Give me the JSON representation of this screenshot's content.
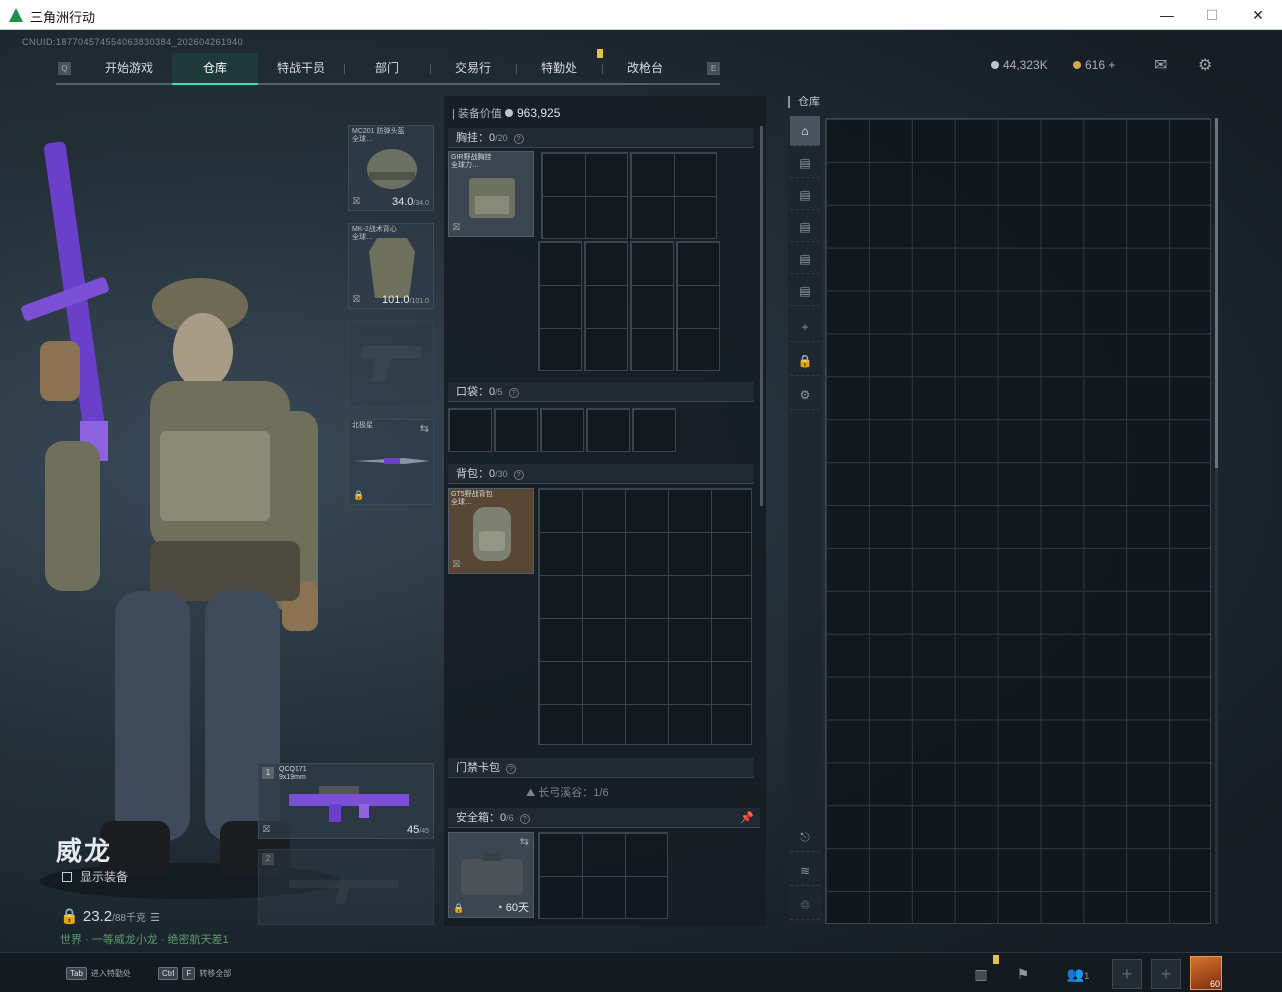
{
  "window": {
    "title": "三角洲行动",
    "minimize": "—",
    "maximize": "☐",
    "close": "✕"
  },
  "uid": "CNUID:18770457455406383038​4_202604261940",
  "nav": {
    "items": [
      "开始游戏",
      "仓库",
      "特战干员",
      "部门",
      "交易行",
      "特勤处",
      "改枪台"
    ],
    "active": "仓库"
  },
  "currency": {
    "silver": "44,323K",
    "gold": "616",
    "plus": "+"
  },
  "character": {
    "name": "威龙",
    "show_equipment": "显示装备",
    "weight": "23.2",
    "weight_max": "/88千克",
    "tip": "世界 · 一等威龙小龙 · 绝密航天差1"
  },
  "equip_slots": {
    "helmet": {
      "label": "MC201 防弹头盔\n全球…",
      "value": "34.0",
      "max": "/34.0"
    },
    "armor": {
      "label": "MK-2战术背心\n全球…",
      "value": "101.0",
      "max": "/101.0"
    },
    "melee": {
      "label": "北极星"
    }
  },
  "weapons": {
    "primary": {
      "num": "1",
      "name": "QCQ171",
      "ammo_type": "9x19mm",
      "ammo": "45",
      "ammo_max": "/45"
    },
    "secondary": {
      "num": "2"
    }
  },
  "middle": {
    "equip_value_label": "装备价值",
    "equip_value": "963,925",
    "chest": {
      "title": "胸挂：",
      "count": "0",
      "max": "/20",
      "item": "GIR野战胸挂\n全球力…"
    },
    "pocket": {
      "title": "口袋：",
      "count": "0",
      "max": "/5"
    },
    "backpack": {
      "title": "背包：",
      "count": "0",
      "max": "/30",
      "item": "GT5野战背包\n全球…"
    },
    "keycard": {
      "title": "门禁卡包"
    },
    "longbow": "长弓溪谷：1/6",
    "safebox": {
      "title": "安全箱：",
      "count": "0",
      "max": "/6",
      "timer": "60天"
    }
  },
  "warehouse": {
    "title": "仓库"
  },
  "bottom": {
    "hint1_key": "Tab",
    "hint1": "进入特勤处",
    "hint2_key1": "Ctrl",
    "hint2_key2": "F",
    "hint2": "转移全部",
    "friends_count": "1",
    "level": "60"
  },
  "colors": {
    "accent": "#3de0a0",
    "badge": "#e6c14a"
  }
}
